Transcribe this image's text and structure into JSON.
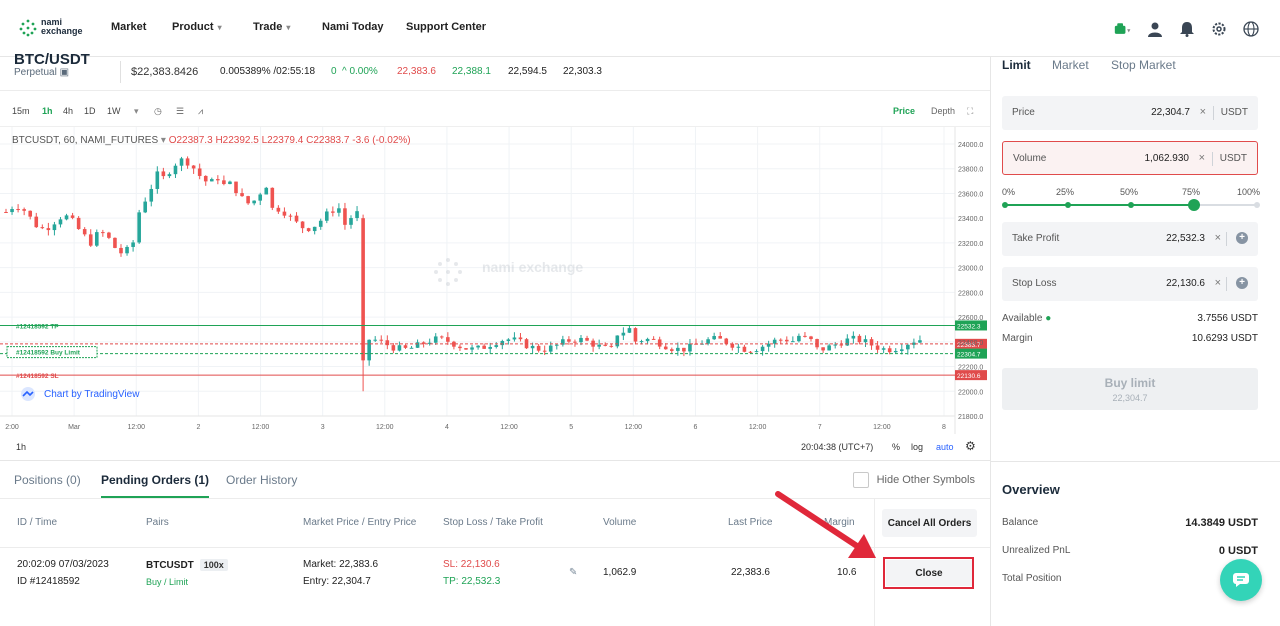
{
  "nav": {
    "logo_line1": "nami",
    "logo_line2": "exchange",
    "items": [
      "Market",
      "Product",
      "Trade",
      "Nami Today",
      "Support Center"
    ]
  },
  "ticker": {
    "symbol": "BTC/USDT",
    "type": "Perpetual",
    "last_price": "$22,383.8426",
    "funding": "0.005389% /02:55:18",
    "change": "0",
    "change_pct": "^ 0.00%",
    "v1": "22,383.6",
    "v2": "22,388.1",
    "v3": "22,594.5",
    "v4": "22,303.3"
  },
  "chart_tools": {
    "intervals": [
      "15m",
      "1h",
      "4h",
      "1D",
      "1W"
    ],
    "active_interval": "1h",
    "price_tab": "Price",
    "depth_tab": "Depth"
  },
  "chart_legend": {
    "symbol": "BTCUSDT, 60, NAMI_FUTURES",
    "o": "O22387.3",
    "h": "H22392.5",
    "l": "L22379.4",
    "c": "C22383.7",
    "chg": "-3.6 (-0.02%)"
  },
  "chart_watermark": "nami exchange",
  "tradingview_credit": "Chart by TradingView",
  "chart_footer": {
    "interval": "1h",
    "time": "20:04:38 (UTC+7)",
    "pct": "%",
    "log": "log",
    "auto": "auto"
  },
  "chart_lines": {
    "tp_label": "#12418592 TP",
    "buy_label": "#12418592 Buy Limit",
    "sl_label": "#12418592 SL",
    "tp_price": "22532.3",
    "last_price": "22383.7",
    "entry_price": "22304.7",
    "sl_price": "22130.6"
  },
  "chart_data": {
    "type": "candlestick",
    "y_ticks": [
      "24000.0",
      "23800.0",
      "23600.0",
      "23400.0",
      "23200.0",
      "23000.0",
      "22800.0",
      "22600.0",
      "22400.0",
      "22200.0",
      "22000.0",
      "21800.0"
    ],
    "ylim": [
      21800,
      24000
    ],
    "x_ticks": [
      "2:00",
      "Mar",
      "12:00",
      "2",
      "12:00",
      "3",
      "12:00",
      "4",
      "12:00",
      "5",
      "12:00",
      "6",
      "12:00",
      "7",
      "12:00",
      "8"
    ],
    "colors": {
      "up": "#26a69a",
      "down": "#ef5350"
    }
  },
  "orders": {
    "tabs": [
      "Positions (0)",
      "Pending Orders (1)",
      "Order History"
    ],
    "hide_other": "Hide Other Symbols",
    "headers": [
      "ID / Time",
      "Pairs",
      "Market Price / Entry Price",
      "Stop Loss / Take Profit",
      "Volume",
      "Last Price",
      "Margin"
    ],
    "cancel_all": "Cancel All Orders",
    "row": {
      "time": "20:02:09 07/03/2023",
      "id": "ID #12418592",
      "pair": "BTCUSDT",
      "leverage": "100x",
      "side": "Buy / Limit",
      "market": "Market: 22,383.6",
      "entry": "Entry: 22,304.7",
      "sl": "SL: 22,130.6",
      "tp": "TP: 22,532.3",
      "volume": "1,062.9",
      "last_price": "22,383.6",
      "margin": "10.6",
      "close": "Close"
    }
  },
  "order_form": {
    "tabs": [
      "Limit",
      "Market",
      "Stop Market"
    ],
    "price_label": "Price",
    "price_value": "22,304.7",
    "unit": "USDT",
    "volume_label": "Volume",
    "volume_value": "1,062.930",
    "slider_labels": [
      "0%",
      "25%",
      "50%",
      "75%",
      "100%"
    ],
    "slider_value": 0.75,
    "tp_label": "Take Profit",
    "tp_value": "22,532.3",
    "sl_label": "Stop Loss",
    "sl_value": "22,130.6",
    "available_label": "Available",
    "available_value": "3.7556 USDT",
    "margin_label": "Margin",
    "margin_value": "10.6293 USDT",
    "buy_label": "Buy limit",
    "buy_price": "22,304.7"
  },
  "overview": {
    "title": "Overview",
    "balance_label": "Balance",
    "balance_value": "14.3849 USDT",
    "pnl_label": "Unrealized PnL",
    "pnl_value": "0 USDT",
    "total_label": "Total Position"
  }
}
